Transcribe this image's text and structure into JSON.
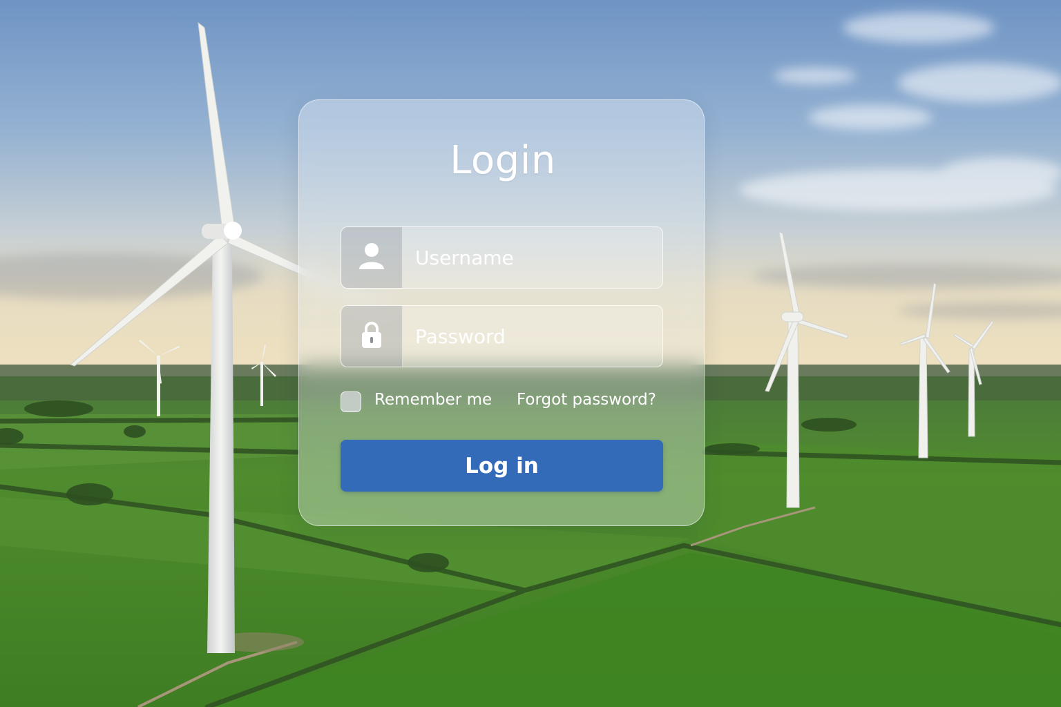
{
  "login_form": {
    "title": "Login",
    "username": {
      "placeholder": "Username",
      "value": "",
      "icon": "user-icon"
    },
    "password": {
      "placeholder": "Password",
      "value": "",
      "icon": "lock-icon"
    },
    "remember_me": {
      "label": "Remember me",
      "checked": false
    },
    "forgot_password_label": "Forgot password?",
    "submit_label": "Log in",
    "accent_color": "#346bb9"
  },
  "background": {
    "subject": "wind-turbines-over-green-fields",
    "sky_colors": [
      "#7396c3",
      "#a9c0d8",
      "#e6d7b8"
    ],
    "field_colors": [
      "#3f7a28",
      "#4f8e30"
    ]
  }
}
